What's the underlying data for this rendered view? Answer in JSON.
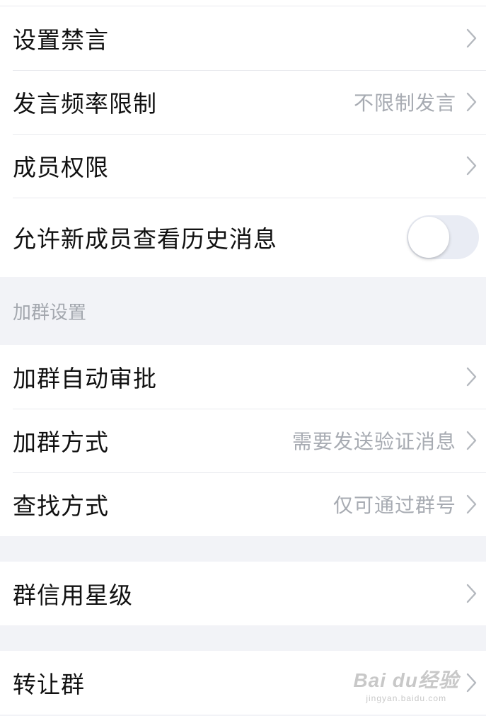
{
  "group_admin": {
    "items": [
      {
        "label": "设置禁言",
        "value": ""
      },
      {
        "label": "发言频率限制",
        "value": "不限制发言"
      },
      {
        "label": "成员权限",
        "value": ""
      },
      {
        "label": "允许新成员查看历史消息",
        "toggle_on": false
      }
    ]
  },
  "join_settings": {
    "header": "加群设置",
    "items": [
      {
        "label": "加群自动审批",
        "value": ""
      },
      {
        "label": "加群方式",
        "value": "需要发送验证消息"
      },
      {
        "label": "查找方式",
        "value": "仅可通过群号"
      }
    ]
  },
  "credit": {
    "items": [
      {
        "label": "群信用星级"
      }
    ]
  },
  "transfer": {
    "items": [
      {
        "label": "转让群"
      }
    ]
  },
  "watermark": {
    "main": "Bai du经验",
    "sub": "jingyan.baidu.com"
  },
  "colors": {
    "background": "#f2f3f7",
    "card": "#ffffff",
    "text_primary": "#111111",
    "text_secondary": "#a7abb2",
    "toggle_off_track": "#e9ecf4"
  },
  "icons": {
    "row_arrow": "chevron-right-icon"
  }
}
